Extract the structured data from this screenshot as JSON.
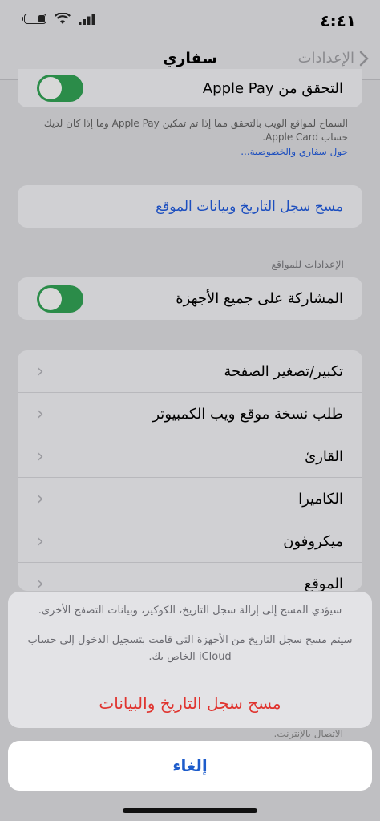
{
  "status": {
    "time": "٤:٤١",
    "battery_level": 0.35
  },
  "nav": {
    "title": "سفاري",
    "back_label": "الإعدادات"
  },
  "apple_pay": {
    "label": "التحقق من Apple Pay",
    "toggle_on": true,
    "footer": "السماح لمواقع الويب بالتحقق مما إذا تم تمكين Apple Pay وما إذا كان لديك حساب Apple Card.",
    "footer_link": "حول سفاري والخصوصية..."
  },
  "clear_history": {
    "label": "مسح سجل التاريخ وبيانات الموقع"
  },
  "site_settings": {
    "header": "الإعدادات للمواقع",
    "share_label": "المشاركة على جميع الأجهزة",
    "share_on": true,
    "items": [
      {
        "label": "تكبير/تصغير الصفحة"
      },
      {
        "label": "طلب نسخة موقع ويب الكمبيوتر"
      },
      {
        "label": "القارئ"
      },
      {
        "label": "الكاميرا"
      },
      {
        "label": "ميكروفون"
      },
      {
        "label": "الموقع"
      }
    ]
  },
  "behind_text": "الاتصال بالإنترنت.",
  "sheet": {
    "message_1": "سيؤدي المسح إلى إزالة سجل التاريخ، الكوكيز، وبيانات التصفح الأخرى.",
    "message_2": "سيتم مسح سجل التاريخ من الأجهزة التي قامت بتسجيل الدخول إلى حساب iCloud الخاص بك.",
    "action_label": "مسح سجل التاريخ والبيانات",
    "cancel_label": "إلغاء"
  },
  "colors": {
    "accent": "#1d4fbf",
    "destructive": "#e0342f",
    "toggle_on": "#2b8c49"
  }
}
